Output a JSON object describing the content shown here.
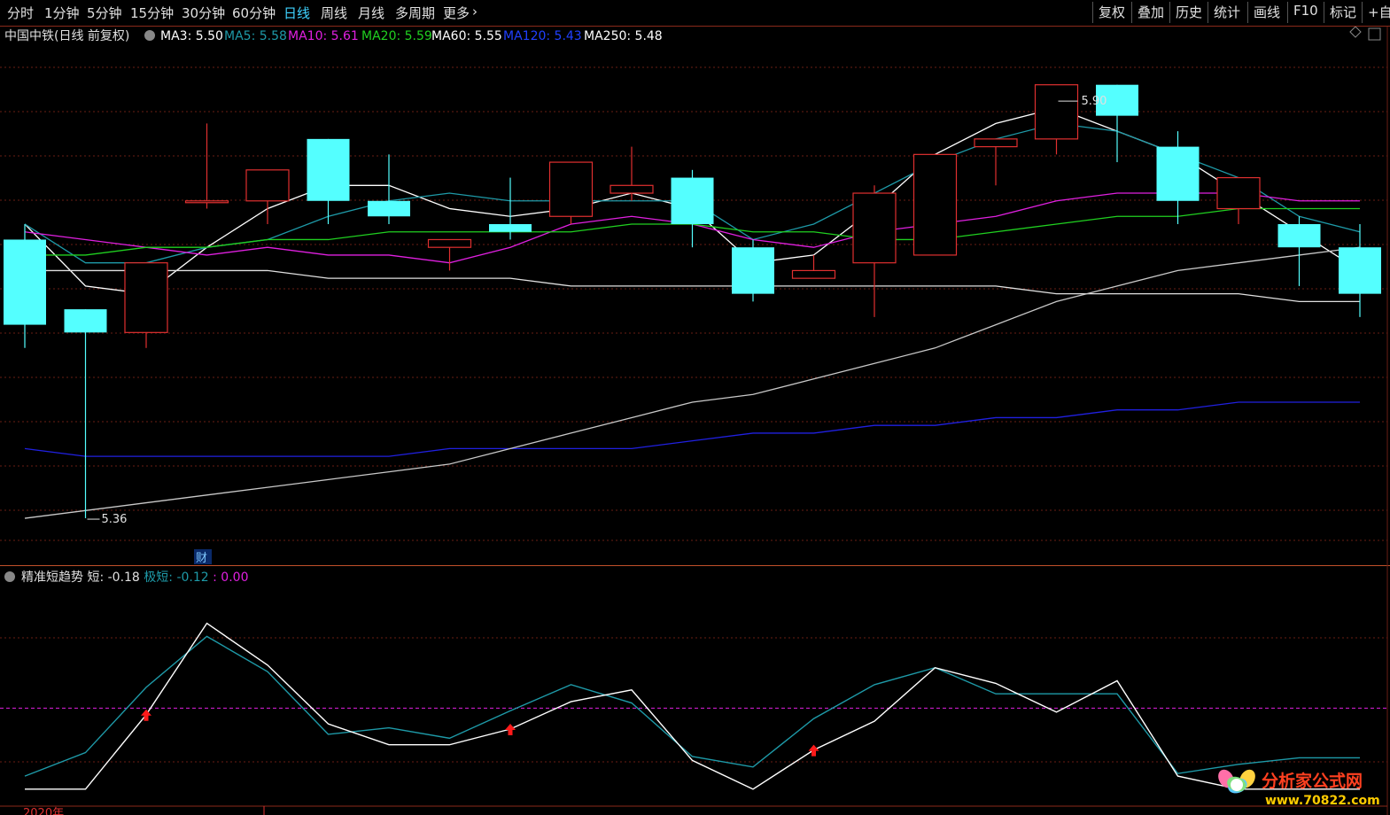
{
  "toolbar": {
    "periods": [
      "分时",
      "1分钟",
      "5分钟",
      "15分钟",
      "30分钟",
      "60分钟",
      "日线",
      "周线",
      "月线",
      "多周期",
      "更多"
    ],
    "active_period": "日线",
    "right_buttons": [
      "复权",
      "叠加",
      "历史",
      "统计",
      "画线",
      "F10",
      "标记",
      "+自"
    ]
  },
  "stock_header": {
    "name": "中国中铁",
    "mode": "(日线 前复权)",
    "ma": [
      {
        "label": "MA3",
        "value": "5.50",
        "color": "#ffffff"
      },
      {
        "label": "MA5",
        "value": "5.58",
        "color": "#1e9aa8"
      },
      {
        "label": "MA10",
        "value": "5.61",
        "color": "#e020e0"
      },
      {
        "label": "MA20",
        "value": "5.59",
        "color": "#20d020"
      },
      {
        "label": "MA60",
        "value": "5.55",
        "color": "#ffffff"
      },
      {
        "label": "MA120",
        "value": "5.43",
        "color": "#2040ff"
      },
      {
        "label": "MA250",
        "value": "5.48",
        "color": "#ffffff"
      }
    ]
  },
  "annotations": {
    "high_label": "5.90",
    "low_label": "5.36",
    "finance_marker": "财"
  },
  "indicator": {
    "name": "精准短趋势",
    "short_label": "短",
    "short_value": "-0.18",
    "ext_label": "极短",
    "ext_value": "-0.12",
    "third_value": "0.00",
    "colors": {
      "short": "#ffffff",
      "ext": "#1e9aa8",
      "zero": "#e020e0"
    }
  },
  "footer": {
    "year_label": "2020年"
  },
  "watermark": {
    "text": "分析家公式网",
    "url": "www.70822.com"
  },
  "chart_data": [
    {
      "type": "candlestick",
      "ylim": [
        5.32,
        5.97
      ],
      "up_color": "#e03030",
      "down_color": "#54ffff",
      "candles": [
        {
          "o": 5.72,
          "h": 5.74,
          "l": 5.58,
          "c": 5.61
        },
        {
          "o": 5.63,
          "h": 5.63,
          "l": 5.36,
          "c": 5.6
        },
        {
          "o": 5.6,
          "h": 5.59,
          "l": 5.58,
          "c": 5.69
        },
        {
          "o": 5.77,
          "h": 5.87,
          "l": 5.76,
          "c": 5.77
        },
        {
          "o": 5.77,
          "h": 5.8,
          "l": 5.74,
          "c": 5.81
        },
        {
          "o": 5.85,
          "h": 5.85,
          "l": 5.74,
          "c": 5.77
        },
        {
          "o": 5.77,
          "h": 5.83,
          "l": 5.74,
          "c": 5.75
        },
        {
          "o": 5.71,
          "h": 5.72,
          "l": 5.68,
          "c": 5.72
        },
        {
          "o": 5.74,
          "h": 5.8,
          "l": 5.72,
          "c": 5.73
        },
        {
          "o": 5.75,
          "h": 5.81,
          "l": 5.74,
          "c": 5.82
        },
        {
          "o": 5.78,
          "h": 5.84,
          "l": 5.77,
          "c": 5.79
        },
        {
          "o": 5.8,
          "h": 5.81,
          "l": 5.71,
          "c": 5.74
        },
        {
          "o": 5.71,
          "h": 5.72,
          "l": 5.64,
          "c": 5.65
        },
        {
          "o": 5.67,
          "h": 5.7,
          "l": 5.67,
          "c": 5.68
        },
        {
          "o": 5.69,
          "h": 5.79,
          "l": 5.62,
          "c": 5.78
        },
        {
          "o": 5.7,
          "h": 5.82,
          "l": 5.79,
          "c": 5.83
        },
        {
          "o": 5.84,
          "h": 5.83,
          "l": 5.79,
          "c": 5.85
        },
        {
          "o": 5.85,
          "h": 5.9,
          "l": 5.83,
          "c": 5.92
        },
        {
          "o": 5.92,
          "h": 5.89,
          "l": 5.82,
          "c": 5.88
        },
        {
          "o": 5.84,
          "h": 5.86,
          "l": 5.74,
          "c": 5.77
        },
        {
          "o": 5.76,
          "h": 5.8,
          "l": 5.74,
          "c": 5.8
        },
        {
          "o": 5.74,
          "h": 5.75,
          "l": 5.66,
          "c": 5.71
        },
        {
          "o": 5.71,
          "h": 5.74,
          "l": 5.62,
          "c": 5.65
        }
      ],
      "ma_series": [
        {
          "name": "MA3",
          "color": "#ffffff",
          "values": [
            5.74,
            5.66,
            5.65,
            5.71,
            5.76,
            5.79,
            5.79,
            5.76,
            5.75,
            5.76,
            5.78,
            5.76,
            5.69,
            5.7,
            5.76,
            5.83,
            5.87,
            5.89,
            5.86,
            5.83,
            5.78,
            5.73,
            5.68
          ]
        },
        {
          "name": "MA5",
          "color": "#1e9aa8",
          "values": [
            5.74,
            5.69,
            5.69,
            5.71,
            5.72,
            5.75,
            5.77,
            5.78,
            5.77,
            5.77,
            5.77,
            5.77,
            5.72,
            5.74,
            5.78,
            5.82,
            5.85,
            5.87,
            5.86,
            5.83,
            5.8,
            5.75,
            5.73
          ]
        },
        {
          "name": "MA10",
          "color": "#e020e0",
          "values": [
            5.73,
            5.72,
            5.71,
            5.7,
            5.71,
            5.7,
            5.7,
            5.69,
            5.71,
            5.74,
            5.75,
            5.74,
            5.72,
            5.71,
            5.73,
            5.74,
            5.75,
            5.77,
            5.78,
            5.78,
            5.78,
            5.77,
            5.77
          ]
        },
        {
          "name": "MA20",
          "color": "#20d020",
          "values": [
            5.7,
            5.7,
            5.71,
            5.71,
            5.72,
            5.72,
            5.73,
            5.73,
            5.73,
            5.73,
            5.74,
            5.74,
            5.73,
            5.73,
            5.72,
            5.72,
            5.73,
            5.74,
            5.75,
            5.75,
            5.76,
            5.76,
            5.76
          ]
        },
        {
          "name": "MA60",
          "color": "#e0e0e0",
          "values": [
            5.68,
            5.68,
            5.68,
            5.68,
            5.68,
            5.67,
            5.67,
            5.67,
            5.67,
            5.66,
            5.66,
            5.66,
            5.66,
            5.66,
            5.66,
            5.66,
            5.66,
            5.65,
            5.65,
            5.65,
            5.65,
            5.64,
            5.64
          ]
        },
        {
          "name": "MA120",
          "color": "#2020e0",
          "values": [
            5.45,
            5.44,
            5.44,
            5.44,
            5.44,
            5.44,
            5.44,
            5.45,
            5.45,
            5.45,
            5.45,
            5.46,
            5.47,
            5.47,
            5.48,
            5.48,
            5.49,
            5.49,
            5.5,
            5.5,
            5.51,
            5.51,
            5.51
          ]
        },
        {
          "name": "MA250",
          "color": "#c8c8c8",
          "values": [
            5.36,
            5.37,
            5.38,
            5.39,
            5.4,
            5.41,
            5.42,
            5.43,
            5.45,
            5.47,
            5.49,
            5.51,
            5.52,
            5.54,
            5.56,
            5.58,
            5.61,
            5.64,
            5.66,
            5.68,
            5.69,
            5.7,
            5.71
          ]
        }
      ]
    },
    {
      "type": "line",
      "ylim": [
        -0.75,
        1.0
      ],
      "zero_line": 0.0,
      "series": [
        {
          "name": "短",
          "color": "#ffffff",
          "values": [
            -0.62,
            -0.62,
            -0.05,
            0.65,
            0.33,
            -0.12,
            -0.28,
            -0.28,
            -0.16,
            0.05,
            0.14,
            -0.4,
            -0.62,
            -0.32,
            -0.1,
            0.31,
            0.19,
            -0.03,
            0.21,
            -0.52,
            -0.62,
            -0.62,
            -0.62
          ]
        },
        {
          "name": "极短",
          "color": "#1e9aa8",
          "values": [
            -0.52,
            -0.34,
            0.16,
            0.55,
            0.28,
            -0.2,
            -0.15,
            -0.23,
            -0.02,
            0.18,
            0.04,
            -0.37,
            -0.45,
            -0.08,
            0.18,
            0.31,
            0.11,
            0.11,
            0.11,
            -0.5,
            -0.43,
            -0.38,
            -0.38
          ]
        }
      ],
      "signals": [
        2,
        8,
        13
      ]
    }
  ]
}
